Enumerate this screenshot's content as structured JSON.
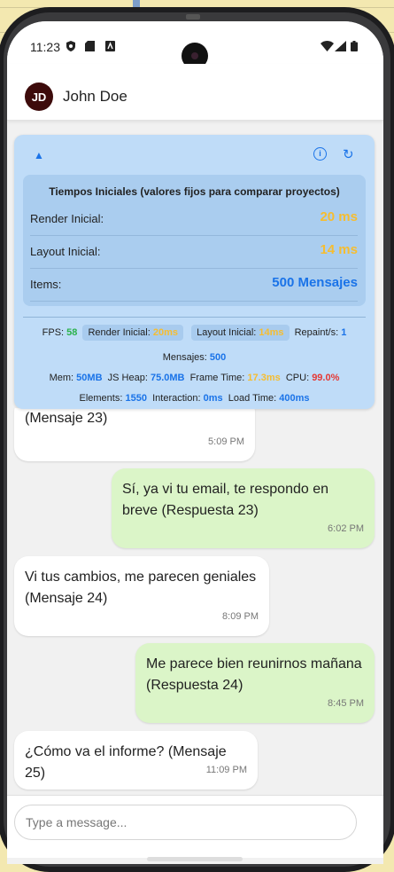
{
  "status_bar": {
    "time": "11:23"
  },
  "header": {
    "avatar_initials": "JD",
    "name": "John Doe"
  },
  "perf_panel": {
    "title": "Tiempos Iniciales (valores fijos para comparar proyectos)",
    "rows": [
      {
        "label": "Render Inicial:",
        "value": "20 ms",
        "color": "#f6bd30"
      },
      {
        "label": "Layout Inicial:",
        "value": "14 ms",
        "color": "#f6bd30"
      },
      {
        "label": "Items:",
        "value": "500 Mensajes",
        "color": "#1a73e8"
      }
    ],
    "stats": {
      "fps_label": "FPS:",
      "fps": "58",
      "render_label": "Render Inicial:",
      "render": "20ms",
      "layout_label": "Layout Inicial:",
      "layout": "14ms",
      "repaint_label": "Repaint/s:",
      "repaint": "1",
      "messages_label": "Mensajes:",
      "messages": "500",
      "mem_label": "Mem:",
      "mem": "50MB",
      "jsheap_label": "JS Heap:",
      "jsheap": "75.0MB",
      "frame_label": "Frame Time:",
      "frame": "17.3ms",
      "cpu_label": "CPU:",
      "cpu": "99.0%",
      "elements_label": "Elements:",
      "elements": "1550",
      "interaction_label": "Interaction:",
      "interaction": "0ms",
      "load_label": "Load Time:",
      "load": "400ms"
    }
  },
  "messages": [
    {
      "text": "(Mensaje 23)",
      "time": "5:09 PM",
      "side": "in"
    },
    {
      "text": "Sí, ya vi tu email, te respondo en breve (Respuesta 23)",
      "time": "6:02 PM",
      "side": "out"
    },
    {
      "text": "Vi tus cambios, me parecen geniales (Mensaje 24)",
      "time": "8:09 PM",
      "side": "in"
    },
    {
      "text": "Me parece bien reunirnos mañana (Respuesta 24)",
      "time": "8:45 PM",
      "side": "out"
    },
    {
      "text": "¿Cómo va el informe? (Mensaje 25)",
      "time": "11:09 PM",
      "side": "in"
    }
  ],
  "composer": {
    "placeholder": "Type a message..."
  },
  "colors": {
    "outgoing_bubble": "#dbf5c8",
    "incoming_bubble": "#ffffff",
    "panel": "#bfdcf8",
    "accent": "#1a73e8"
  }
}
